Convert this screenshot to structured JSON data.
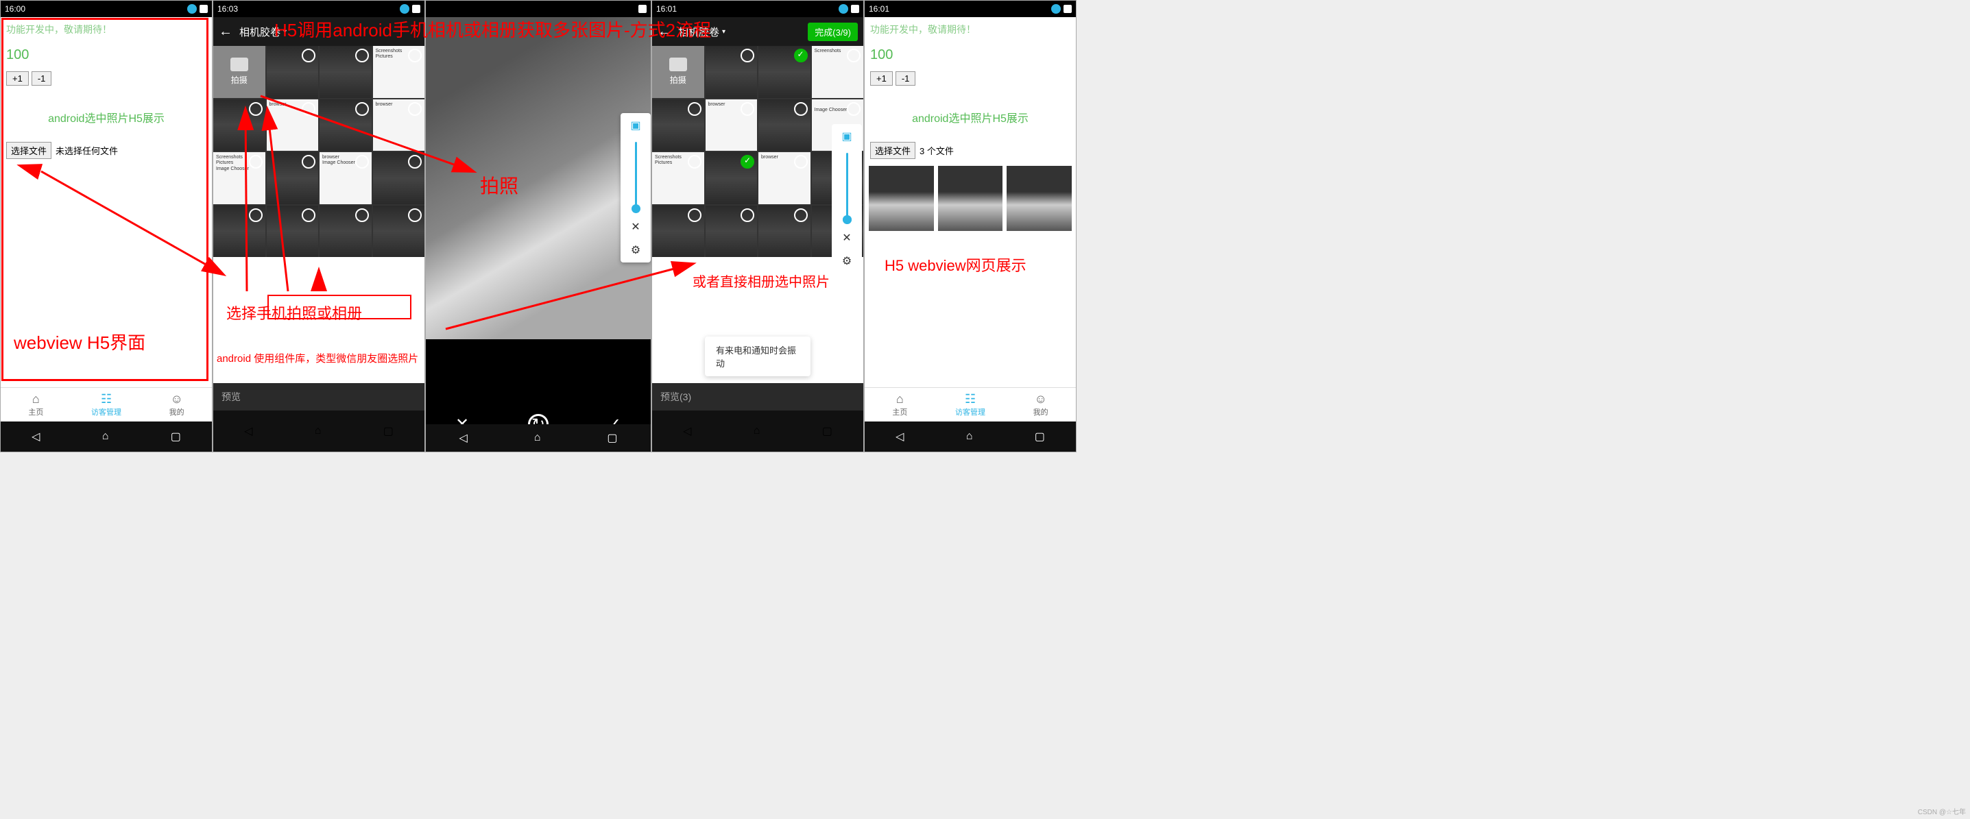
{
  "title_overlay": "H5调用android手机相机或相册获取多张图片-方式2流程",
  "annot": {
    "webview_h5": "webview H5界面",
    "choose_cam": "选择手机拍照或相册",
    "lib_note": "android 使用组件库，类型微信朋友圈选照片",
    "take_photo": "拍照",
    "or_gallery": "或者直接相册选中照片",
    "h5_show": "H5 webview网页展示"
  },
  "status": {
    "time1": "16:00",
    "time2": "16:03",
    "time3": "16:01",
    "time4": "16:01",
    "time5": "16:01"
  },
  "wv": {
    "dev": "功能开发中，敬请期待！",
    "num": "100",
    "plus": "+1",
    "minus": "-1",
    "atitle": "android选中照片H5展示",
    "choose": "选择文件",
    "nofile": "未选择任何文件",
    "three": "3 个文件"
  },
  "tabs": {
    "home": "主页",
    "guest": "访客管理",
    "mine": "我的"
  },
  "picker": {
    "title": "相机胶卷",
    "shoot": "拍摄",
    "preview": "预览",
    "preview_n": "预览(3)",
    "done": "完成(3/9)",
    "info1": "Image Chooser"
  },
  "toast": "有来电和通知时会振动",
  "watermark": "CSDN @☆七年"
}
